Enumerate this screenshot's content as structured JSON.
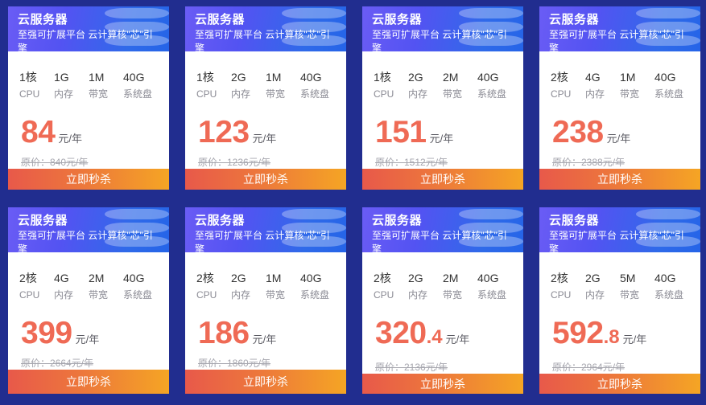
{
  "page": {
    "background_color": "#212d8f",
    "header_gradient_from": "#6a5cf5",
    "header_gradient_to": "#2564e8",
    "button_gradient_from": "#e8594a",
    "button_gradient_to": "#f5a524",
    "price_color": "#ef6a55"
  },
  "labels": {
    "cpu": "CPU",
    "memory": "内存",
    "bandwidth": "带宽",
    "disk": "系统盘",
    "currency_unit": "元/年",
    "buy_button": "立即秒杀",
    "deco_icon": "database-stack-icon"
  },
  "cards": [
    {
      "title": "云服务器",
      "subtitle": "至强可扩展平台 云计算核\"芯\"引擎",
      "specs": [
        {
          "value": "1核",
          "label": "CPU"
        },
        {
          "value": "1G",
          "label": "内存"
        },
        {
          "value": "1M",
          "label": "带宽"
        },
        {
          "value": "40G",
          "label": "系统盘"
        }
      ],
      "price_int": "84",
      "price_dec": "",
      "price_unit": "元/年",
      "original_price": "原价：840元/年",
      "button": "立即秒杀"
    },
    {
      "title": "云服务器",
      "subtitle": "至强可扩展平台 云计算核\"芯\"引擎",
      "specs": [
        {
          "value": "1核",
          "label": "CPU"
        },
        {
          "value": "2G",
          "label": "内存"
        },
        {
          "value": "1M",
          "label": "带宽"
        },
        {
          "value": "40G",
          "label": "系统盘"
        }
      ],
      "price_int": "123",
      "price_dec": "",
      "price_unit": "元/年",
      "original_price": "原价：1236元/年",
      "button": "立即秒杀"
    },
    {
      "title": "云服务器",
      "subtitle": "至强可扩展平台 云计算核\"芯\"引擎",
      "specs": [
        {
          "value": "1核",
          "label": "CPU"
        },
        {
          "value": "2G",
          "label": "内存"
        },
        {
          "value": "2M",
          "label": "带宽"
        },
        {
          "value": "40G",
          "label": "系统盘"
        }
      ],
      "price_int": "151",
      "price_dec": "",
      "price_unit": "元/年",
      "original_price": "原价：1512元/年",
      "button": "立即秒杀"
    },
    {
      "title": "云服务器",
      "subtitle": "至强可扩展平台 云计算核\"芯\"引擎",
      "specs": [
        {
          "value": "2核",
          "label": "CPU"
        },
        {
          "value": "4G",
          "label": "内存"
        },
        {
          "value": "1M",
          "label": "带宽"
        },
        {
          "value": "40G",
          "label": "系统盘"
        }
      ],
      "price_int": "238",
      "price_dec": "",
      "price_unit": "元/年",
      "original_price": "原价：2388元/年",
      "button": "立即秒杀"
    },
    {
      "title": "云服务器",
      "subtitle": "至强可扩展平台 云计算核\"芯\"引擎",
      "specs": [
        {
          "value": "2核",
          "label": "CPU"
        },
        {
          "value": "4G",
          "label": "内存"
        },
        {
          "value": "2M",
          "label": "带宽"
        },
        {
          "value": "40G",
          "label": "系统盘"
        }
      ],
      "price_int": "399",
      "price_dec": "",
      "price_unit": "元/年",
      "original_price": "原价：2664元/年",
      "button": "立即秒杀"
    },
    {
      "title": "云服务器",
      "subtitle": "至强可扩展平台 云计算核\"芯\"引擎",
      "specs": [
        {
          "value": "2核",
          "label": "CPU"
        },
        {
          "value": "2G",
          "label": "内存"
        },
        {
          "value": "1M",
          "label": "带宽"
        },
        {
          "value": "40G",
          "label": "系统盘"
        }
      ],
      "price_int": "186",
      "price_dec": "",
      "price_unit": "元/年",
      "original_price": "原价：1860元/年",
      "button": "立即秒杀"
    },
    {
      "title": "云服务器",
      "subtitle": "至强可扩展平台 云计算核\"芯\"引擎",
      "specs": [
        {
          "value": "2核",
          "label": "CPU"
        },
        {
          "value": "2G",
          "label": "内存"
        },
        {
          "value": "2M",
          "label": "带宽"
        },
        {
          "value": "40G",
          "label": "系统盘"
        }
      ],
      "price_int": "320",
      "price_dec": ".4",
      "price_unit": "元/年",
      "original_price": "原价：2136元/年",
      "button": "立即秒杀"
    },
    {
      "title": "云服务器",
      "subtitle": "至强可扩展平台 云计算核\"芯\"引擎",
      "specs": [
        {
          "value": "2核",
          "label": "CPU"
        },
        {
          "value": "2G",
          "label": "内存"
        },
        {
          "value": "5M",
          "label": "带宽"
        },
        {
          "value": "40G",
          "label": "系统盘"
        }
      ],
      "price_int": "592",
      "price_dec": ".8",
      "price_unit": "元/年",
      "original_price": "原价：2964元/年",
      "button": "立即秒杀"
    }
  ]
}
